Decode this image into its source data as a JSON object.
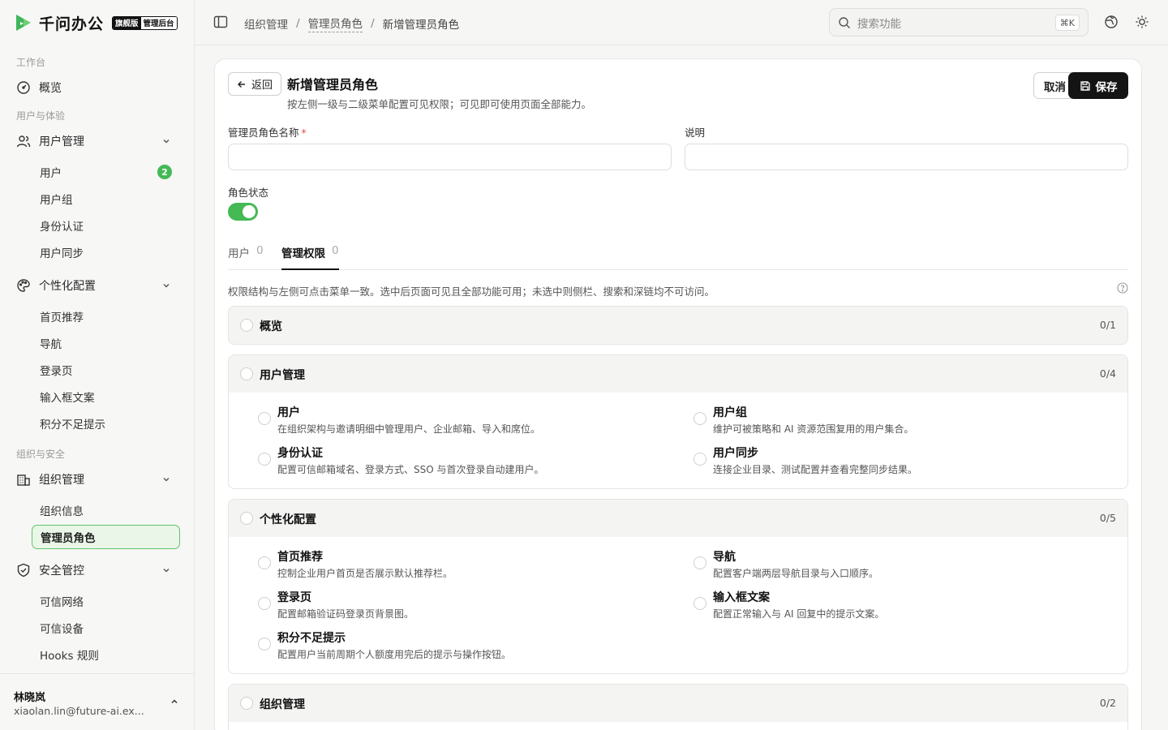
{
  "brand": {
    "name": "千问办公",
    "tag_primary": "旗舰版",
    "tag_secondary": "管理后台"
  },
  "sidebar": {
    "sections": {
      "workspace": "工作台",
      "users_experience": "用户与体验",
      "org_security": "组织与安全"
    },
    "overview": "概览",
    "user_mgmt": {
      "label": "用户管理",
      "items": [
        "用户",
        "用户组",
        "身份认证",
        "用户同步"
      ],
      "user_badge": "2"
    },
    "personalize": {
      "label": "个性化配置",
      "items": [
        "首页推荐",
        "导航",
        "登录页",
        "输入框文案",
        "积分不足提示"
      ]
    },
    "org_mgmt": {
      "label": "组织管理",
      "items": [
        "组织信息",
        "管理员角色"
      ]
    },
    "security": {
      "label": "安全管控",
      "items": [
        "可信网络",
        "可信设备",
        "Hooks 规则"
      ]
    },
    "user": {
      "name": "林晓岚",
      "email": "xiaolan.lin@future-ai.ex..."
    }
  },
  "topbar": {
    "breadcrumb": [
      "组织管理",
      "管理员角色",
      "新增管理员角色"
    ],
    "search_placeholder": "搜索功能",
    "search_shortcut": "⌘K"
  },
  "page": {
    "back_label": "返回",
    "title": "新增管理员角色",
    "subtitle": "按左侧一级与二级菜单配置可见权限；可见即可使用页面全部能力。",
    "cancel_label": "取消",
    "save_label": "保存",
    "name_label": "管理员角色名称",
    "name_required": "*",
    "name_value": "",
    "desc_label": "说明",
    "desc_value": "",
    "status_label": "角色状态",
    "status_enabled": true,
    "tabs": [
      {
        "label": "用户",
        "count": "0"
      },
      {
        "label": "管理权限",
        "count": "0",
        "active": true
      }
    ],
    "hint": "权限结构与左侧可点击菜单一致。选中后页面可见且全部功能可用；未选中则侧栏、搜索和深链均不可访问。"
  },
  "permission_groups": [
    {
      "title": "概览",
      "count": "0/1",
      "items": []
    },
    {
      "title": "用户管理",
      "count": "0/4",
      "items": [
        {
          "title": "用户",
          "desc": "在组织架构与邀请明细中管理用户、企业邮箱、导入和席位。"
        },
        {
          "title": "用户组",
          "desc": "维护可被策略和 AI 资源范围复用的用户集合。"
        },
        {
          "title": "身份认证",
          "desc": "配置可信邮箱域名、登录方式、SSO 与首次登录自动建用户。"
        },
        {
          "title": "用户同步",
          "desc": "连接企业目录、测试配置并查看完整同步结果。"
        }
      ]
    },
    {
      "title": "个性化配置",
      "count": "0/5",
      "items": [
        {
          "title": "首页推荐",
          "desc": "控制企业用户首页是否展示默认推荐栏。"
        },
        {
          "title": "导航",
          "desc": "配置客户端两层导航目录与入口顺序。"
        },
        {
          "title": "登录页",
          "desc": "配置邮箱验证码登录页背景图。"
        },
        {
          "title": "输入框文案",
          "desc": "配置正常输入与 AI 回复中的提示文案。"
        },
        {
          "title": "积分不足提示",
          "desc": "配置用户当前周期个人额度用完后的提示与操作按钮。"
        }
      ]
    },
    {
      "title": "组织管理",
      "count": "0/2",
      "items": []
    }
  ],
  "colors": {
    "accent": "#45b954",
    "active_bg": "#eaf6e8",
    "primary_btn": "#141414"
  }
}
